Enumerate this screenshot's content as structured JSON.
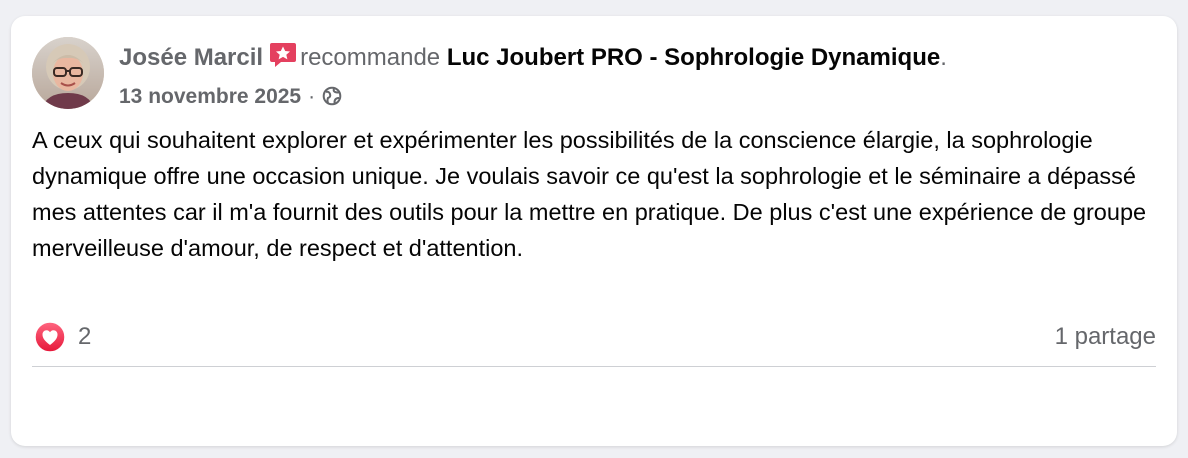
{
  "post": {
    "author_name": "Josée Marcil",
    "verb": "recommande",
    "page_name": "Luc Joubert PRO - Sophrologie Dynamique",
    "period": ".",
    "date": "13 novembre 2025",
    "separator": "·",
    "audience_icon": "globe-icon",
    "recommend_icon": "recommendation-star-icon",
    "text": "A ceux qui souhaitent explorer et expérimenter les possibilités de la conscience élargie, la sophrologie dynamique offre une occasion unique. Je voulais savoir ce qu'est la sophrologie et le séminaire a dépassé mes attentes car il m'a fournit des outils pour la mettre en pratique. De plus c'est une expérience de groupe merveilleuse d'amour, de respect et d'attention."
  },
  "engagement": {
    "reaction_icon": "love-reaction-icon",
    "reaction_count": "2",
    "shares": "1 partage"
  },
  "colors": {
    "page_background": "#eff0f4",
    "card_background": "#ffffff",
    "secondary_text": "#65676b",
    "primary_text": "#050505",
    "recommend_badge": "#e4405f",
    "love_reaction": "#f33e58"
  }
}
